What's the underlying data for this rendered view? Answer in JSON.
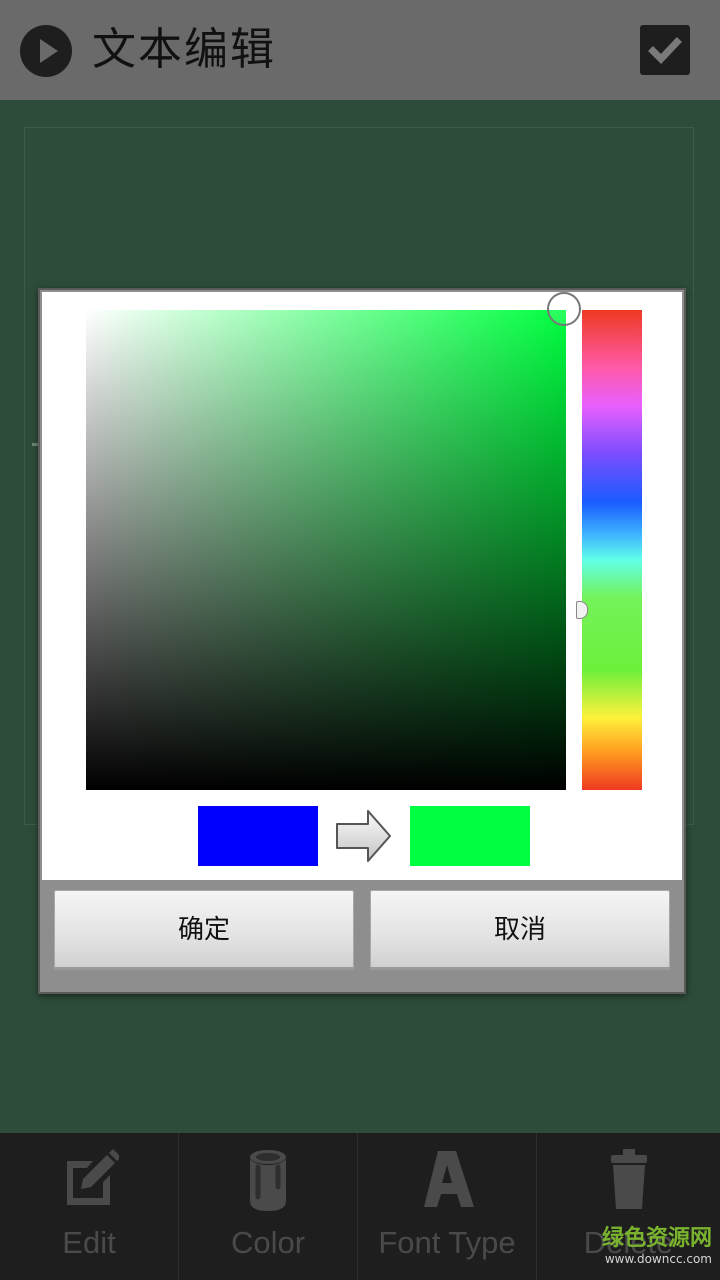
{
  "header": {
    "title": "文本编辑",
    "play_icon": "play-circle-icon",
    "confirm_icon": "checkmark-icon"
  },
  "dialog": {
    "picker": {
      "hue_color": "#00ff40",
      "old_color": "#0000ff",
      "new_color": "#00ff40"
    },
    "ok_label": "确定",
    "cancel_label": "取消"
  },
  "toolbar": {
    "items": [
      {
        "label": "Edit",
        "icon": "edit-pencil-icon"
      },
      {
        "label": "Color",
        "icon": "paint-bucket-icon"
      },
      {
        "label": "Font Type",
        "icon": "font-a-icon"
      },
      {
        "label": "Delete",
        "icon": "trash-icon"
      }
    ]
  },
  "watermark": {
    "text": "绿色资源网",
    "url": "www.downcc.com"
  }
}
